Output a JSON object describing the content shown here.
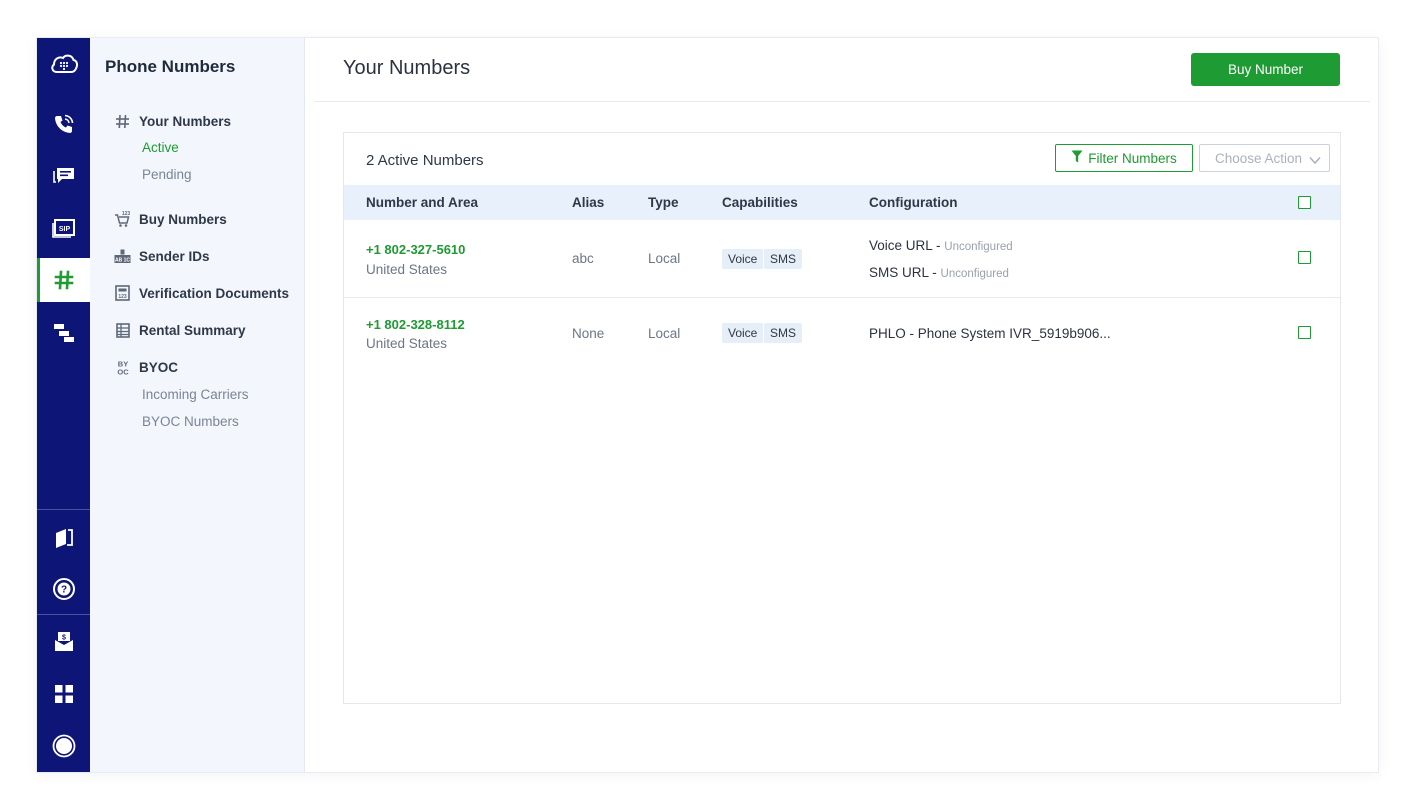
{
  "rail": {
    "items": [
      {
        "icon": "cloud-logo-icon"
      },
      {
        "icon": "voice-call-icon"
      },
      {
        "icon": "messaging-icon"
      },
      {
        "icon": "sip-trunk-icon",
        "label": "SIP"
      },
      {
        "icon": "hash-icon",
        "active": true
      },
      {
        "icon": "flow-icon"
      },
      {
        "icon": "docs-book-icon"
      },
      {
        "icon": "help-icon"
      },
      {
        "icon": "billing-icon"
      },
      {
        "icon": "apps-grid-icon"
      },
      {
        "icon": "profile-avatar-icon"
      }
    ]
  },
  "subnav": {
    "title": "Phone Numbers",
    "items": {
      "your_numbers": "Your Numbers",
      "active": "Active",
      "pending": "Pending",
      "buy_numbers": "Buy Numbers",
      "sender_ids": "Sender IDs",
      "verification_documents": "Verification Documents",
      "rental_summary": "Rental Summary",
      "byoc": "BYOC",
      "incoming_carriers": "Incoming Carriers",
      "byoc_numbers": "BYOC Numbers"
    },
    "byoc_icon_text": "BY OC"
  },
  "main": {
    "title": "Your Numbers",
    "buy_button": "Buy Number",
    "count_label": "2 Active Numbers",
    "filter_button": "Filter Numbers",
    "action_select": "Choose Action",
    "columns": {
      "number": "Number and Area",
      "alias": "Alias",
      "type": "Type",
      "capabilities": "Capabilities",
      "configuration": "Configuration"
    },
    "rows": [
      {
        "number": "+1 802-327-5610",
        "area": "United States",
        "alias": "abc",
        "type": "Local",
        "cap1": "Voice",
        "cap2": "SMS",
        "voice_url_label": "Voice URL - ",
        "voice_url_value": "Unconfigured",
        "sms_url_label": "SMS URL - ",
        "sms_url_value": "Unconfigured"
      },
      {
        "number": "+1 802-328-8112",
        "area": "United States",
        "alias": "None",
        "type": "Local",
        "cap1": "Voice",
        "cap2": "SMS",
        "config": "PHLO - Phone System IVR_5919b906..."
      }
    ]
  },
  "colors": {
    "brand_navy": "#0d1576",
    "accent_green": "#1e9b32",
    "subnav_bg": "#f3f7fd",
    "table_header_bg": "#e8f0fb"
  }
}
